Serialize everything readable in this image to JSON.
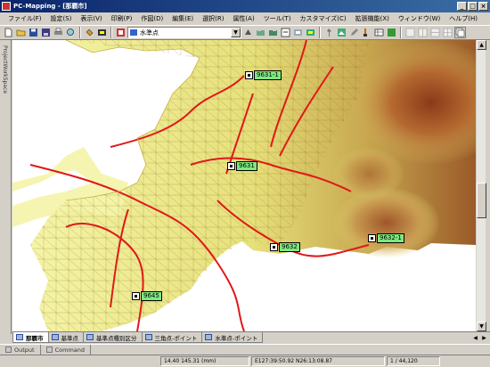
{
  "window": {
    "title": "PC-Mapping - [那覇市]",
    "buttons": [
      "_",
      "□",
      "×"
    ]
  },
  "menubar": {
    "items": [
      "ファイル(F)",
      "設定(S)",
      "表示(V)",
      "印刷(P)",
      "作図(D)",
      "編集(E)",
      "選択(R)",
      "属性(A)",
      "ツール(T)",
      "カスタマイズ(C)",
      "拡張機能(X)",
      "ウィンドウ(W)",
      "ヘルプ(H)"
    ]
  },
  "toolbar": {
    "layer_select_value": "水準点"
  },
  "left_panel": {
    "label": "ProjectWorkSpace"
  },
  "map": {
    "points": [
      {
        "label": "9631-1"
      },
      {
        "label": "9631"
      },
      {
        "label": "9632"
      },
      {
        "label": "9632-1"
      },
      {
        "label": "9645"
      }
    ]
  },
  "layer_tabs": [
    {
      "label": "那覇市",
      "active": true
    },
    {
      "label": "基準点",
      "active": false
    },
    {
      "label": "基準点種別区分",
      "active": false
    },
    {
      "label": "三角点-ポイント",
      "active": false
    },
    {
      "label": "水準点-ポイント",
      "active": false
    }
  ],
  "output_tabs": [
    {
      "label": "Output"
    },
    {
      "label": "Command"
    }
  ],
  "statusbar": {
    "coords_mm": "14.40 145.31 (mm)",
    "coords_geo": "E127:39:50.92 N26:13:08.87",
    "scale": "1 / 44,120"
  },
  "colors": {
    "title_bar": "#0a246a",
    "label_bg": "#7fe87f",
    "road": "#e02020",
    "terrain_low": "#f2f2a0",
    "terrain_high": "#8b4513"
  }
}
